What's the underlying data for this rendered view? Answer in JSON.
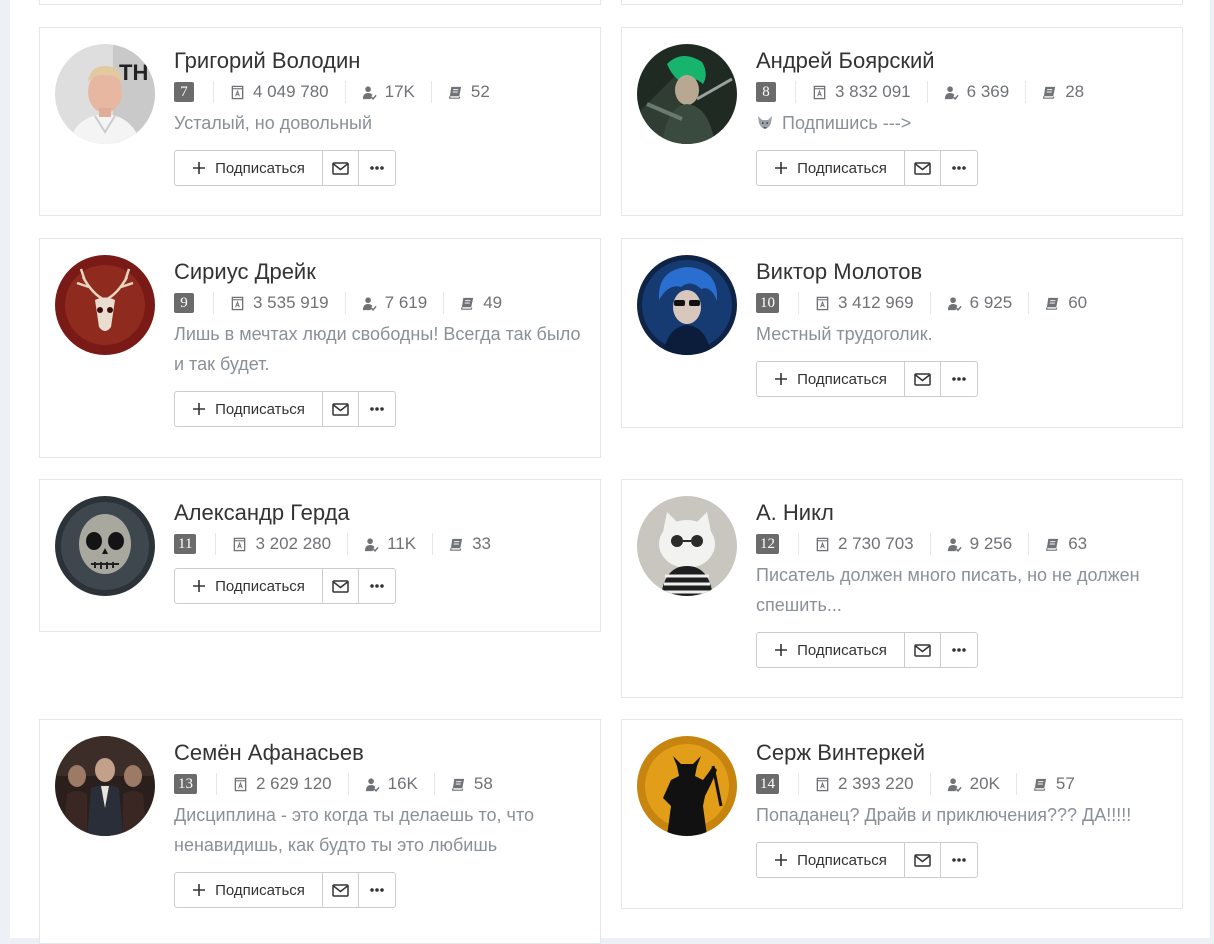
{
  "accent": {
    "rank_bg": "#6b6b6b",
    "status_text": "#8a9097"
  },
  "authors": [
    {
      "name": "Григорий Володин",
      "rank": "7",
      "books_read": "4 049 780",
      "followers": "17K",
      "books": "52",
      "status": "Усталый, но довольный",
      "emoji": "",
      "avatar": "young-man-photo"
    },
    {
      "name": "Андрей Боярский",
      "rank": "8",
      "books_read": "3 832 091",
      "followers": "6 369",
      "books": "28",
      "status": "Подпишись --->",
      "emoji": "wolf-icon",
      "avatar": "green-hair-warrior-art"
    },
    {
      "name": "Сириус Дрейк",
      "rank": "9",
      "books_read": "3 535 919",
      "followers": "7 619",
      "books": "49",
      "status": "Лишь в мечтах люди свободны! Всегда так было и так будет.",
      "emoji": "",
      "avatar": "deer-skull-art"
    },
    {
      "name": "Виктор Молотов",
      "rank": "10",
      "books_read": "3 412 969",
      "followers": "6 925",
      "books": "60",
      "status": "Местный трудоголик.",
      "emoji": "",
      "avatar": "blue-hair-man-art"
    },
    {
      "name": "Александр Герда",
      "rank": "11",
      "books_read": "3 202 280",
      "followers": "11K",
      "books": "33",
      "status": "",
      "emoji": "",
      "avatar": "skull-face-art"
    },
    {
      "name": "А. Никл",
      "rank": "12",
      "books_read": "2 730 703",
      "followers": "9 256",
      "books": "63",
      "status": "Писатель должен много писать, но не должен спешить...",
      "emoji": "",
      "avatar": "cat-with-glasses-photo"
    },
    {
      "name": "Семён Афанасьев",
      "rank": "13",
      "books_read": "2 629 120",
      "followers": "16K",
      "books": "58",
      "status": "Дисциплина - это когда ты делаешь то, что ненавидишь, как будто ты это любишь",
      "emoji": "",
      "avatar": "men-in-suits-photo"
    },
    {
      "name": "Серж Винтеркей",
      "rank": "14",
      "books_read": "2 393 220",
      "followers": "20K",
      "books": "57",
      "status": "Попаданец? Драйв и приключения??? ДА!!!!!",
      "emoji": "",
      "avatar": "viking-silhouette-moon-art"
    }
  ],
  "buttons": {
    "subscribe": "Подписаться",
    "message_icon": "envelope-icon",
    "more_icon": "ellipsis-icon"
  }
}
